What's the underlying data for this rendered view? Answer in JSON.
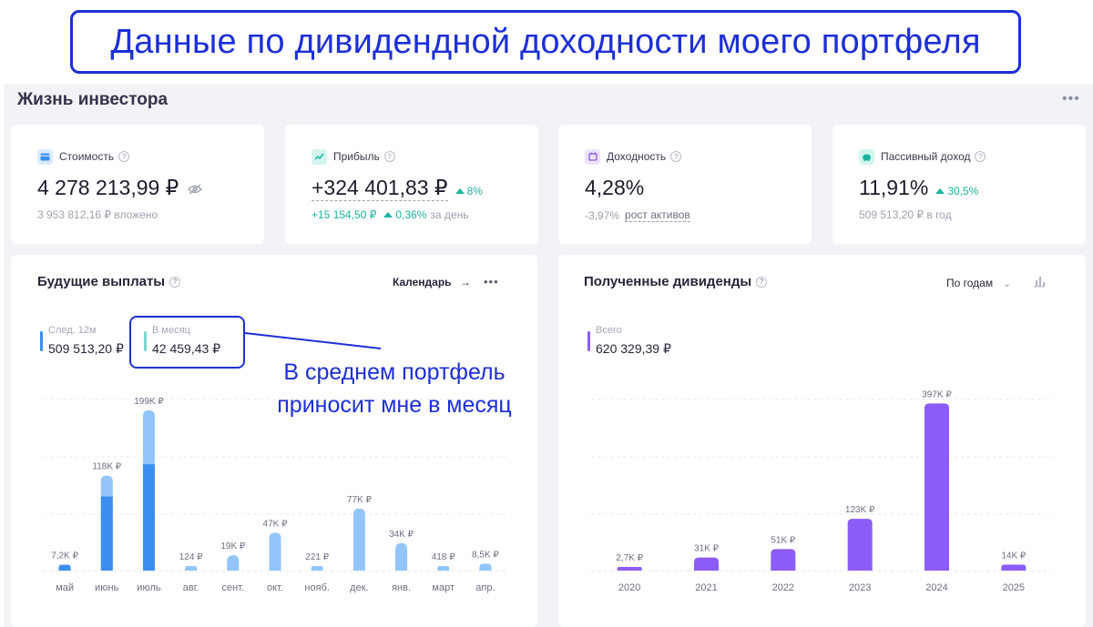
{
  "banner": {
    "text": "Данные по дивидендной доходности моего портфеля"
  },
  "app": {
    "title": "Жизнь инвестора",
    "more": "•••"
  },
  "cards": [
    {
      "icon": "wallet-icon",
      "color": "#3b8ef0",
      "label": "Стоимость",
      "value": "4 278 213,99 ₽",
      "sub": "3 953 812,16 ₽ вложено"
    },
    {
      "icon": "chart-line-icon",
      "color": "#1bb59f",
      "label": "Прибыль",
      "value": "+324 401,83 ₽",
      "delta": "8%",
      "sub_main": "+15 154,50 ₽",
      "sub_delta": "0,36%",
      "sub_tail": "за день"
    },
    {
      "icon": "calendar-icon",
      "color": "#8e54e9",
      "label": "Доходность",
      "value": "4,28%",
      "sub_main": "-3,97%",
      "sub_link": "рост активов"
    },
    {
      "icon": "piggy-bank-icon",
      "color": "#1bb59f",
      "label": "Пассивный доход",
      "value": "11,91%",
      "delta": "30,5%",
      "sub": "509 513,20 ₽ в год"
    }
  ],
  "future": {
    "title": "Будущие выплаты",
    "calendar_label": "Календарь",
    "more": "•••",
    "legend": [
      {
        "label": "След. 12м",
        "value": "509 513,20 ₽",
        "color": "#3b8ef0"
      },
      {
        "label": "В месяц",
        "value": "42 459,43 ₽",
        "color": "#7ed6cc"
      }
    ]
  },
  "received": {
    "title": "Полученные дивиденды",
    "period_label": "По годам",
    "legend": {
      "label": "Всего",
      "value": "620 329,39 ₽",
      "color": "#8b5cf6"
    }
  },
  "annotation": {
    "line1": "В среднем портфель",
    "line2": "приносит мне в месяц"
  },
  "chart_data": [
    {
      "type": "bar",
      "title": "Будущие выплаты",
      "categories": [
        "май",
        "июнь",
        "июль",
        "авг.",
        "сент.",
        "окт.",
        "нояб.",
        "дек.",
        "янв.",
        "март",
        "апр."
      ],
      "labels": [
        "7,2K ₽",
        "118K ₽",
        "199K ₽",
        "124 ₽",
        "19K ₽",
        "47K ₽",
        "221 ₽",
        "77K ₽",
        "34K ₽",
        "418 ₽",
        "8,5K ₽"
      ],
      "values": [
        7200,
        118000,
        199000,
        124,
        19000,
        47000,
        221,
        77000,
        34000,
        418,
        8500
      ],
      "confirmed": [
        7200,
        92000,
        132000,
        0,
        0,
        0,
        0,
        0,
        0,
        0,
        0
      ],
      "colors": {
        "confirmed": "#3b8ef0",
        "expected": "#93c5fb"
      },
      "ylim": [
        0,
        200000
      ]
    },
    {
      "type": "bar",
      "title": "Полученные дивиденды",
      "categories": [
        "2020",
        "2021",
        "2022",
        "2023",
        "2024",
        "2025"
      ],
      "labels": [
        "2,7K ₽",
        "31K ₽",
        "51K ₽",
        "123K ₽",
        "397K ₽",
        "14K ₽"
      ],
      "values": [
        2700,
        31000,
        51000,
        123000,
        397000,
        14000
      ],
      "color": "#8b5cf6",
      "ylim": [
        0,
        400000
      ]
    }
  ]
}
